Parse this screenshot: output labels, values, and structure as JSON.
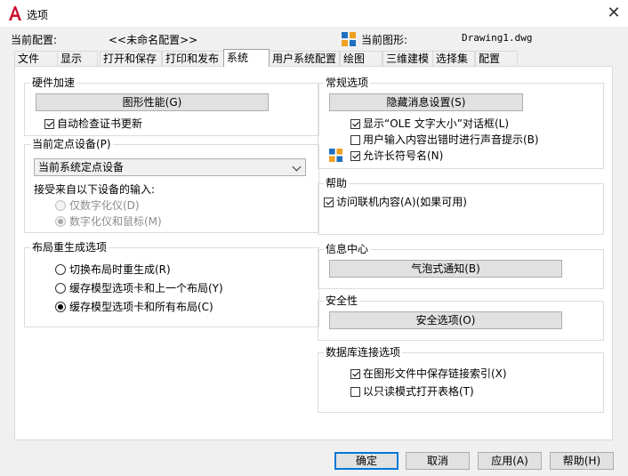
{
  "window": {
    "title": "选项",
    "close_symbol": "✕"
  },
  "header": {
    "profile_label": "当前配置:",
    "profile_value": "<<未命名配置>>",
    "drawing_label": "当前图形:",
    "drawing_value": "Drawing1.dwg"
  },
  "tabs": [
    "文件",
    "显示",
    "打开和保存",
    "打印和发布",
    "系统",
    "用户系统配置",
    "绘图",
    "三维建模",
    "选择集",
    "配置"
  ],
  "active_tab": "系统",
  "hardware": {
    "title": "硬件加速",
    "perf_button": "图形性能(G)",
    "auto_check": {
      "label": "自动检查证书更新",
      "checked": true
    }
  },
  "pointing": {
    "title": "当前定点设备(P)",
    "select_value": "当前系统定点设备",
    "accept_label": "接受来自以下设备的输入:",
    "options": [
      {
        "label": "仅数字化仪(D)",
        "checked": false
      },
      {
        "label": "数字化仪和鼠标(M)",
        "checked": true
      }
    ]
  },
  "layout_regen": {
    "title": "布局重生成选项",
    "options": [
      {
        "label": "切换布局时重生成(R)",
        "checked": false
      },
      {
        "label": "缓存模型选项卡和上一个布局(Y)",
        "checked": false
      },
      {
        "label": "缓存模型选项卡和所有布局(C)",
        "checked": true
      }
    ]
  },
  "general": {
    "title": "常规选项",
    "hidden_msg_button": "隐藏消息设置(S)",
    "checks": [
      {
        "label": "显示“OLE 文字大小”对话框(L)",
        "checked": true
      },
      {
        "label": "用户输入内容出错时进行声音提示(B)",
        "checked": false
      },
      {
        "label": "允许长符号名(N)",
        "checked": true
      }
    ]
  },
  "help": {
    "title": "帮助",
    "online": {
      "label": "访问联机内容(A)(如果可用)",
      "checked": true
    }
  },
  "infocenter": {
    "title": "信息中心",
    "balloon_button": "气泡式通知(B)"
  },
  "security": {
    "title": "安全性",
    "security_button": "安全选项(O)"
  },
  "db": {
    "title": "数据库连接选项",
    "checks": [
      {
        "label": "在图形文件中保存链接索引(X)",
        "checked": true
      },
      {
        "label": "以只读模式打开表格(T)",
        "checked": false
      }
    ]
  },
  "footer": {
    "ok": "确定",
    "cancel": "取消",
    "apply": "应用(A)",
    "help": "帮助(H)"
  },
  "colors": {
    "accent": "#0078d7",
    "brand": "#c8102e",
    "window_bg": "#f0f0f0"
  }
}
